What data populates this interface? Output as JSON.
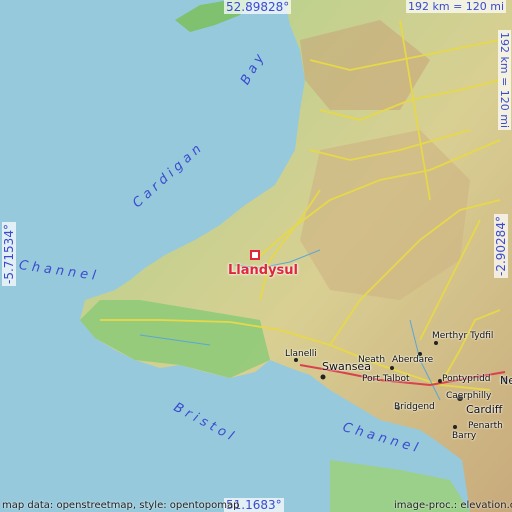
{
  "map": {
    "center_town": "Llandysul",
    "coords": {
      "top_lat": "52.89828°",
      "bottom_lat": "51.1683°",
      "left_lon": "-5.71534°",
      "right_lon": "-2.90284°"
    },
    "scale": {
      "horizontal": "192 km = 120 mi",
      "vertical": "192 km = 120 mi"
    },
    "water_labels": {
      "bay_a": "Cardigan",
      "bay_b": "Bay",
      "channel": "Channel",
      "bristol": "Bristol",
      "channel2": "Channel"
    },
    "places": {
      "llanelli": "Llanelli",
      "swansea": "Swansea",
      "neath": "Neath",
      "aberdare": "Aberdare",
      "merthyr": "Merthyr Tydfil",
      "port_talbot": "Port Talbot",
      "pontypridd": "Pontypridd",
      "caerphilly": "Caerphilly",
      "bridgend": "Bridgend",
      "cardiff": "Cardiff",
      "penarth": "Penarth",
      "barry": "Barry",
      "newport_partial": "Ne"
    },
    "footer": {
      "left": "map data: openstreetmap, style: opentopomap",
      "right": "image-proc.: elevation.city"
    },
    "colors": {
      "sea": "#96c9dc",
      "lowland": "#9bd08a",
      "upland": "#d9cf93",
      "highland": "#c9a87a",
      "roads": "#e6d84a",
      "marker": "#e0263c"
    }
  }
}
